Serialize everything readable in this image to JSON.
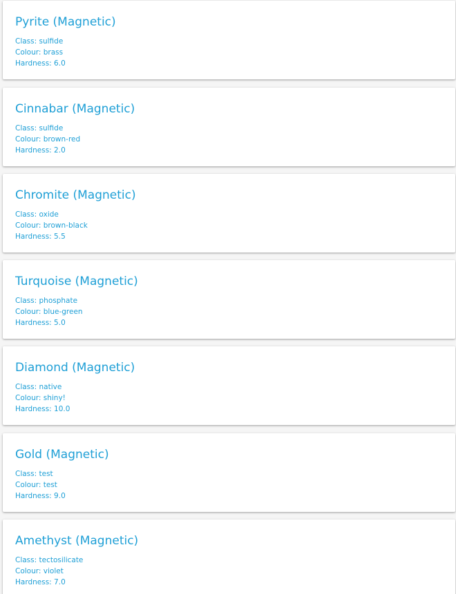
{
  "minerals": [
    {
      "title": "Pyrite (Magnetic)",
      "class": "Class: sulfide",
      "colour": "Colour: brass",
      "hardness": "Hardness: 6.0"
    },
    {
      "title": "Cinnabar (Magnetic)",
      "class": "Class: sulfide",
      "colour": "Colour: brown-red",
      "hardness": "Hardness: 2.0"
    },
    {
      "title": "Chromite (Magnetic)",
      "class": "Class: oxide",
      "colour": "Colour: brown-black",
      "hardness": "Hardness: 5.5"
    },
    {
      "title": "Turquoise (Magnetic)",
      "class": "Class: phosphate",
      "colour": "Colour: blue-green",
      "hardness": "Hardness: 5.0"
    },
    {
      "title": "Diamond (Magnetic)",
      "class": "Class: native",
      "colour": "Colour: shiny!",
      "hardness": "Hardness: 10.0"
    },
    {
      "title": "Gold (Magnetic)",
      "class": "Class: test",
      "colour": "Colour: test",
      "hardness": "Hardness: 9.0"
    },
    {
      "title": "Amethyst (Magnetic)",
      "class": "Class: tectosilicate",
      "colour": "Colour: violet",
      "hardness": "Hardness: 7.0"
    }
  ],
  "colors": {
    "accent": "#1e9fd6",
    "background": "#f5f5f5",
    "card": "#ffffff"
  }
}
